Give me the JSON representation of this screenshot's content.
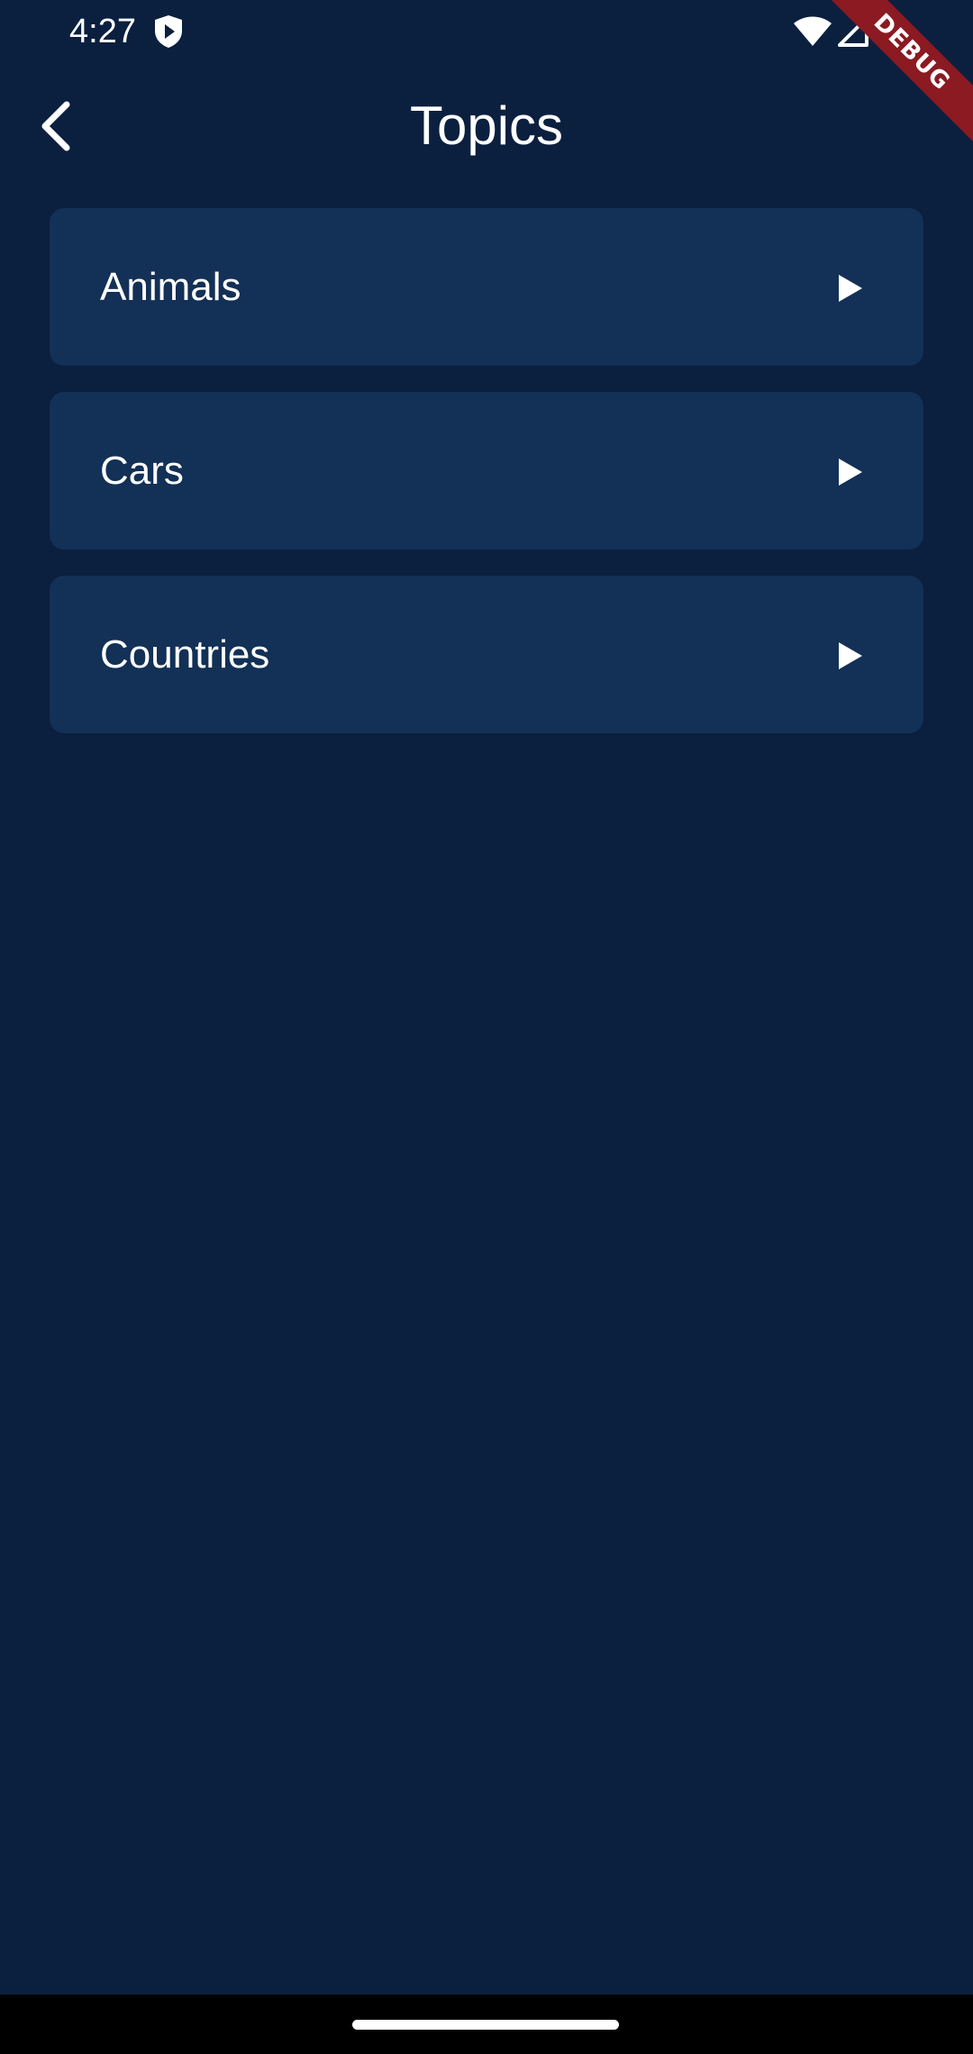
{
  "status_bar": {
    "time": "4:27",
    "icons": [
      "shield-play-icon",
      "wifi-icon",
      "signal-icon"
    ]
  },
  "debug_banner": {
    "label": "DEBUG",
    "color": "#8b1a22"
  },
  "app_bar": {
    "back_icon": "chevron-left-icon",
    "title": "Topics"
  },
  "topics": [
    {
      "label": "Animals",
      "icon": "play-icon"
    },
    {
      "label": "Cars",
      "icon": "play-icon"
    },
    {
      "label": "Countries",
      "icon": "play-icon"
    }
  ],
  "colors": {
    "background": "#0b1f3f",
    "card": "#133056",
    "text": "#ffffff"
  }
}
